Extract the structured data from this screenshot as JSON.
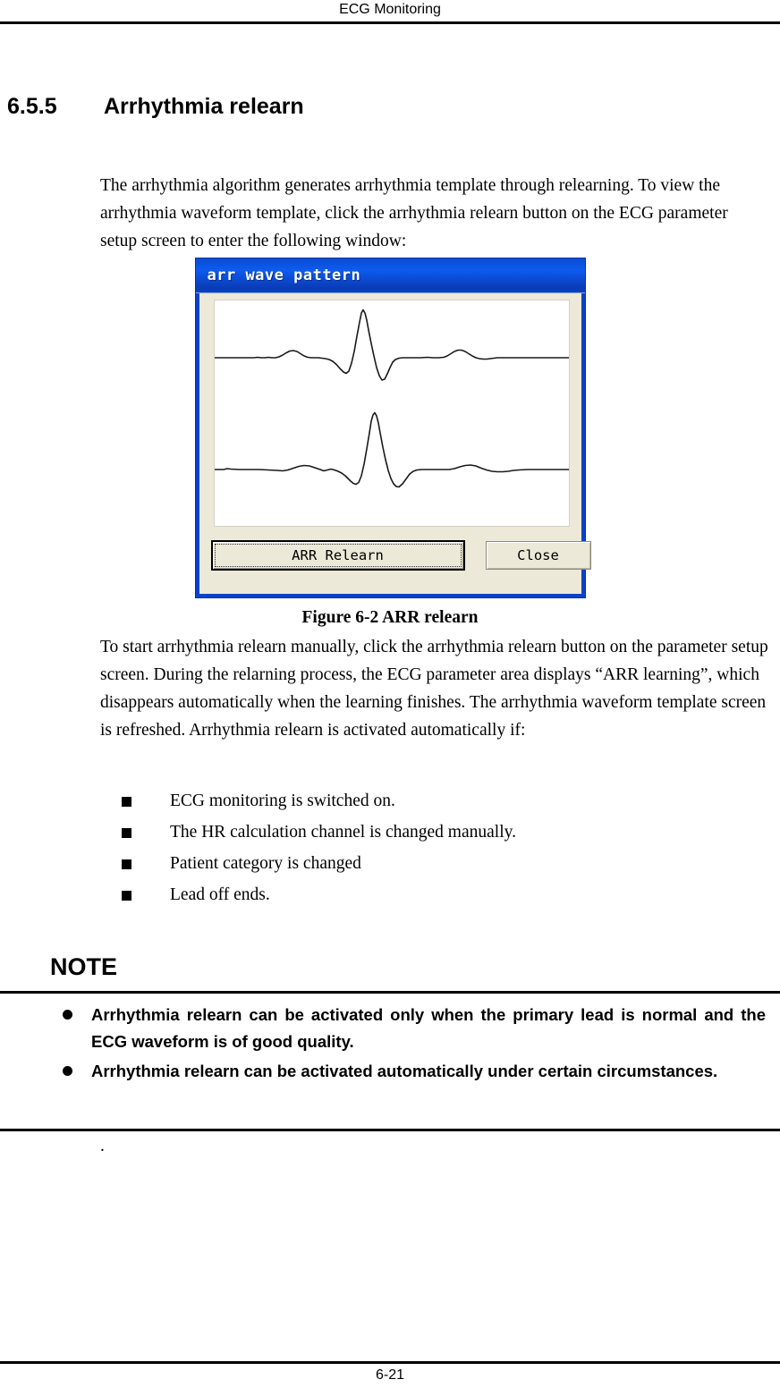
{
  "header": {
    "running_title": "ECG Monitoring"
  },
  "section": {
    "number": "6.5.5",
    "title": "Arrhythmia relearn"
  },
  "paragraphs": {
    "intro": "The arrhythmia algorithm generates arrhythmia template through relearning. To view the arrhythmia waveform template, click the arrhythmia relearn button on the ECG parameter setup screen to enter the following window:",
    "after_figure": "To start arrhythmia relearn manually, click the arrhythmia relearn button on the parameter setup screen. During the relarning process, the ECG parameter area displays “ARR learning”, which disappears automatically when the learning finishes. The arrhythmia waveform template screen is refreshed. Arrhythmia relearn is activated automatically if:"
  },
  "dialog": {
    "title": "arr wave pattern",
    "relearn_button": "ARR Relearn",
    "close_button": "Close",
    "titlebar_color": "#0d5cf0",
    "client_color": "#ece9d8",
    "waveform_color": "#1a1a1a",
    "panel_color": "#ffffff"
  },
  "figure": {
    "caption": "Figure 6-2 ARR relearn"
  },
  "auto_trigger_list": [
    "ECG monitoring is switched on.",
    "The HR calculation channel is changed manually.",
    "Patient category is changed",
    "Lead off ends."
  ],
  "note": {
    "heading": "NOTE",
    "items": [
      "Arrhythmia relearn can be activated only when the primary lead is normal and the ECG waveform is of good quality.",
      "Arrhythmia relearn can be activated automatically under certain circumstances."
    ],
    "trailing_text": "."
  },
  "footer": {
    "page_number": "6-21"
  }
}
